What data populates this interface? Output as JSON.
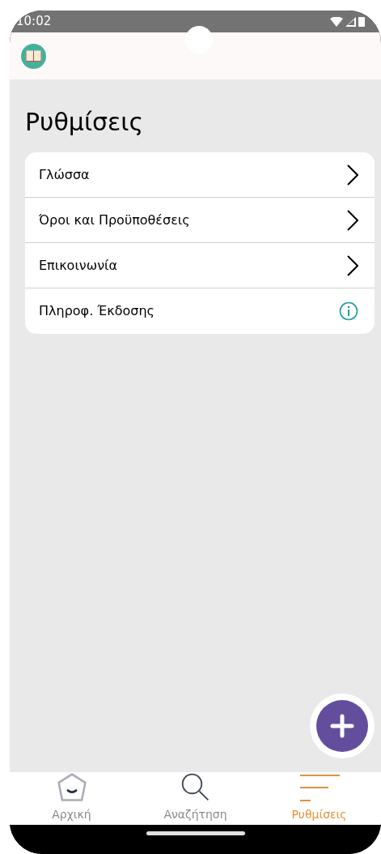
{
  "status_bar": {
    "time": "10:02"
  },
  "title": "Ρυθμίσεις",
  "settings": [
    {
      "label": "Γλώσσα",
      "kind": "chevron"
    },
    {
      "label": "Όροι και Προϋποθέσεις",
      "kind": "chevron"
    },
    {
      "label": "Επικοινωνία",
      "kind": "chevron"
    },
    {
      "label": "Πληροφ. Έκδοσης",
      "kind": "info"
    }
  ],
  "bottom_nav": [
    {
      "label": "Αρχική",
      "kind": "home",
      "selected": false
    },
    {
      "label": "Αναζήτηση",
      "kind": "search",
      "selected": false
    },
    {
      "label": "Ρυθμίσεις",
      "kind": "menu",
      "selected": true
    }
  ]
}
